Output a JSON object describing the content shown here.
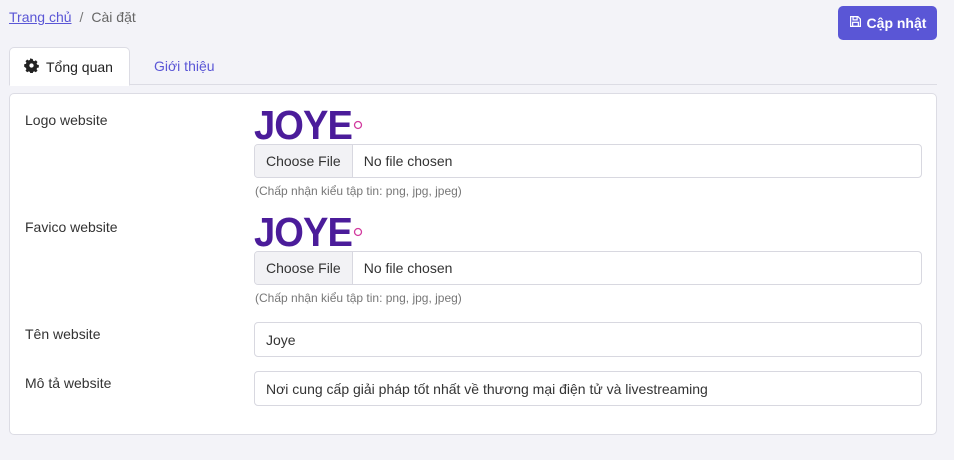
{
  "breadcrumb": {
    "home": "Trang chủ",
    "separator": "/",
    "current": "Cài đặt"
  },
  "toolbar": {
    "update_label": "Cập nhật",
    "accent": "#5a56d6"
  },
  "tabs": [
    {
      "label": "Tổng quan",
      "icon": "gear-icon",
      "active": true
    },
    {
      "label": "Giới thiệu",
      "active": false
    }
  ],
  "form": {
    "logo": {
      "label": "Logo website",
      "logo_text": "JOYE",
      "file_button": "Choose File",
      "file_status": "No file chosen",
      "hint": "(Chấp nhận kiểu tập tin: png, jpg, jpeg)"
    },
    "favicon": {
      "label": "Favico website",
      "logo_text": "JOYE",
      "file_button": "Choose File",
      "file_status": "No file chosen",
      "hint": "(Chấp nhận kiểu tập tin: png, jpg, jpeg)"
    },
    "site_name": {
      "label": "Tên website",
      "value": "Joye"
    },
    "site_desc": {
      "label": "Mô tả website",
      "value": "Nơi cung cấp giải pháp tốt nhất về thương mại điện tử và livestreaming"
    }
  },
  "colors": {
    "logo_purple": "#4b1c9a",
    "logo_pink": "#d23a9e"
  }
}
